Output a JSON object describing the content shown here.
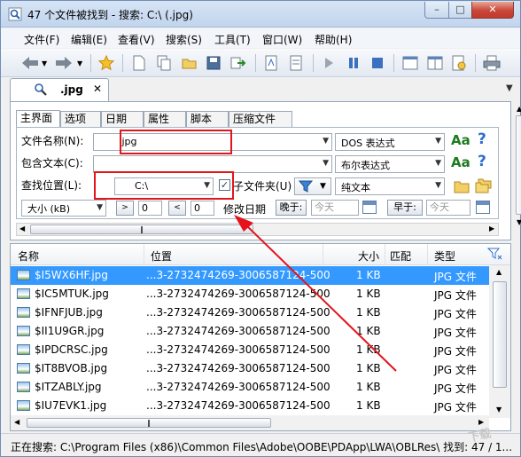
{
  "window": {
    "title": "47 个文件被找到 - 搜索: C:\\ (.jpg)",
    "min": "–",
    "max": "□",
    "close": "✕"
  },
  "menu": [
    "文件(F)",
    "编辑(E)",
    "查看(V)",
    "搜索(S)",
    "工具(T)",
    "窗口(W)",
    "帮助(H)"
  ],
  "toolbar": {
    "icons": [
      "back-icon",
      "forward-icon",
      "favorite-star-icon",
      "new-document-icon",
      "copy-document-icon",
      "open-folder-icon",
      "save-icon",
      "export-icon",
      "report-icon",
      "report-alt-icon",
      "play-icon",
      "pause-icon",
      "stop-icon",
      "window-cascade-icon",
      "window-tile-icon",
      "settings-icon",
      "print-icon"
    ]
  },
  "doc_tab": {
    "label": ".jpg",
    "close": "✕"
  },
  "tabs": [
    "主界面",
    "选项",
    "日期",
    "属性",
    "脚本",
    "压缩文件"
  ],
  "filename": {
    "label": "文件名称(N):",
    "value": ".jpg",
    "mode": "DOS 表达式"
  },
  "contains": {
    "label": "包含文本(C):",
    "value": "",
    "mode": "布尔表达式"
  },
  "location": {
    "label": "查找位置(L):",
    "value": "C:\\",
    "subfolders_label": "子文件夹(U)",
    "subfolders_checked": true,
    "mode": "纯文本"
  },
  "size": {
    "unit": "大小 (kB)",
    "gt": ">",
    "gt_value": "0",
    "lt": "<",
    "lt_value": "0"
  },
  "date": {
    "label": "修改日期",
    "after_label": "晚于:",
    "after_value": "今天",
    "before_label": "早于:",
    "before_value": "今天"
  },
  "aa_label": "Aa",
  "help_label": "?",
  "grip": "‖",
  "columns": [
    "名称",
    "位置",
    "大小",
    "匹配",
    "类型"
  ],
  "rows": [
    {
      "name": "$I5WX6HF.jpg",
      "path": "...3-2732474269-3006587124-500",
      "size": "1 KB",
      "type": "JPG 文件"
    },
    {
      "name": "$IC5MTUK.jpg",
      "path": "...3-2732474269-3006587124-500",
      "size": "1 KB",
      "type": "JPG 文件"
    },
    {
      "name": "$IFNFJUB.jpg",
      "path": "...3-2732474269-3006587124-500",
      "size": "1 KB",
      "type": "JPG 文件"
    },
    {
      "name": "$II1U9GR.jpg",
      "path": "...3-2732474269-3006587124-500",
      "size": "1 KB",
      "type": "JPG 文件"
    },
    {
      "name": "$IPDCRSC.jpg",
      "path": "...3-2732474269-3006587124-500",
      "size": "1 KB",
      "type": "JPG 文件"
    },
    {
      "name": "$IT8BVOB.jpg",
      "path": "...3-2732474269-3006587124-500",
      "size": "1 KB",
      "type": "JPG 文件"
    },
    {
      "name": "$ITZABLY.jpg",
      "path": "...3-2732474269-3006587124-500",
      "size": "1 KB",
      "type": "JPG 文件"
    },
    {
      "name": "$IU7EVK1.jpg",
      "path": "...3-2732474269-3006587124-500",
      "size": "1 KB",
      "type": "JPG 文件"
    }
  ],
  "status": "正在搜索: C:\\Program Files (x86)\\Common Files\\Adobe\\OOBE\\PDApp\\LWA\\OBLRes\\ 找到: 47 / 1...",
  "watermark": "下载",
  "colors": {
    "selection": "#3399ff",
    "highlight_box": "#e3141b",
    "annotation_arrow": "#e3141b"
  }
}
